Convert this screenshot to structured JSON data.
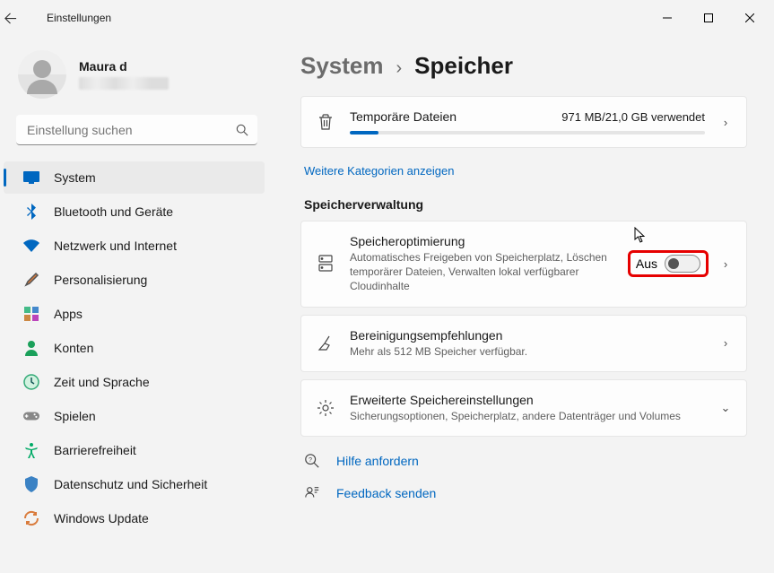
{
  "window": {
    "title": "Einstellungen"
  },
  "profile": {
    "name": "Maura d"
  },
  "search": {
    "placeholder": "Einstellung suchen"
  },
  "nav": {
    "items": [
      {
        "label": "System",
        "icon": "display",
        "active": true
      },
      {
        "label": "Bluetooth und Geräte",
        "icon": "bluetooth"
      },
      {
        "label": "Netzwerk und Internet",
        "icon": "wifi"
      },
      {
        "label": "Personalisierung",
        "icon": "brush"
      },
      {
        "label": "Apps",
        "icon": "apps"
      },
      {
        "label": "Konten",
        "icon": "person"
      },
      {
        "label": "Zeit und Sprache",
        "icon": "clock"
      },
      {
        "label": "Spielen",
        "icon": "gamepad"
      },
      {
        "label": "Barrierefreiheit",
        "icon": "accessibility"
      },
      {
        "label": "Datenschutz und Sicherheit",
        "icon": "shield"
      },
      {
        "label": "Windows Update",
        "icon": "update"
      }
    ]
  },
  "breadcrumb": {
    "parent": "System",
    "current": "Speicher"
  },
  "tempFiles": {
    "title": "Temporäre Dateien",
    "usage": "971 MB/21,0 GB verwendet",
    "percent": 8
  },
  "moreCategories": "Weitere Kategorien anzeigen",
  "sectionTitle": "Speicherverwaltung",
  "storageSense": {
    "title": "Speicheroptimierung",
    "desc": "Automatisches Freigeben von Speicherplatz, Löschen temporärer Dateien, Verwalten lokal verfügbarer Cloudinhalte",
    "state": "Aus"
  },
  "cleanup": {
    "title": "Bereinigungsempfehlungen",
    "desc": "Mehr als 512 MB Speicher verfügbar."
  },
  "advanced": {
    "title": "Erweiterte Speichereinstellungen",
    "desc": "Sicherungsoptionen, Speicherplatz, andere Datenträger und Volumes"
  },
  "help": {
    "request": "Hilfe anfordern",
    "feedback": "Feedback senden"
  }
}
